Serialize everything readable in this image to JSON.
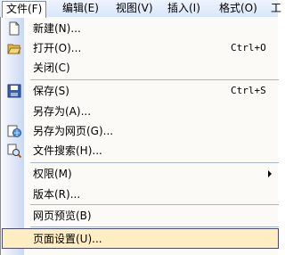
{
  "menubar": {
    "items": [
      {
        "label": "文件(F)"
      },
      {
        "label": "编辑(E)"
      },
      {
        "label": "视图(V)"
      },
      {
        "label": "插入(I)"
      },
      {
        "label": "格式(O)"
      },
      {
        "label": "工"
      }
    ]
  },
  "menu": {
    "new": {
      "label": "新建(N)..."
    },
    "open": {
      "label": "打开(O)...",
      "shortcut": "Ctrl+O"
    },
    "close": {
      "label": "关闭(C)"
    },
    "save": {
      "label": "保存(S)",
      "shortcut": "Ctrl+S"
    },
    "save_as": {
      "label": "另存为(A)..."
    },
    "save_as_web": {
      "label": "另存为网页(G)..."
    },
    "file_search": {
      "label": "文件搜索(H)..."
    },
    "permission": {
      "label": "权限(M)"
    },
    "versions": {
      "label": "版本(R)..."
    },
    "web_preview": {
      "label": "网页预览(B)"
    },
    "page_setup": {
      "label": "页面设置(U)..."
    }
  }
}
